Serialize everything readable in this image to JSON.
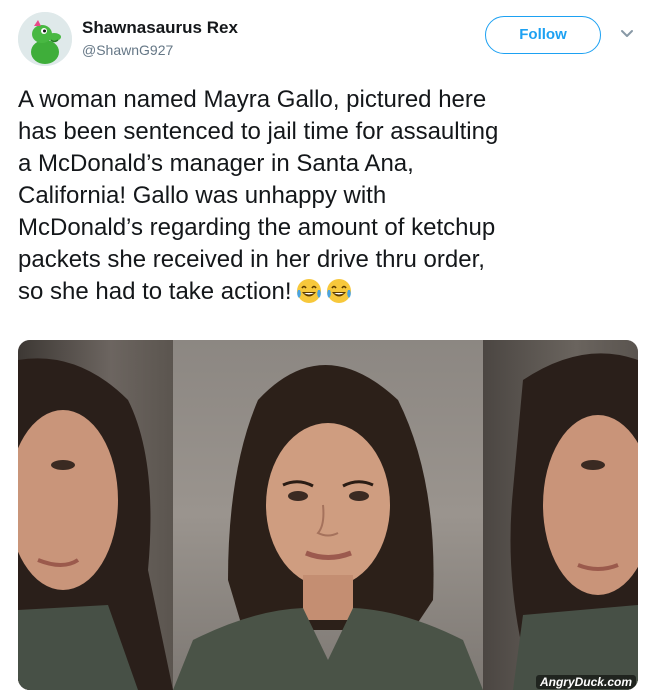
{
  "user": {
    "display_name": "Shawnasaurus Rex",
    "handle": "@ShawnG927",
    "avatar_icon": "green-dinosaur-avatar"
  },
  "follow_button": {
    "label": "Follow",
    "color": "#1da1f2"
  },
  "menu": {
    "icon": "chevron-down-icon"
  },
  "tweet": {
    "text": "A woman named Mayra Gallo, pictured here\nhas been sentenced to jail time for assaulting\na McDonald’s manager in Santa Ana,\nCalifornia! Gallo was unhappy with\nMcDonald’s regarding the amount of ketchup\npackets she received in her drive thru order,\nso she had to take action!",
    "emoji": [
      "face-with-tears-of-joy",
      "face-with-tears-of-joy"
    ]
  },
  "photo": {
    "watermark": "AngryDuck.com"
  }
}
